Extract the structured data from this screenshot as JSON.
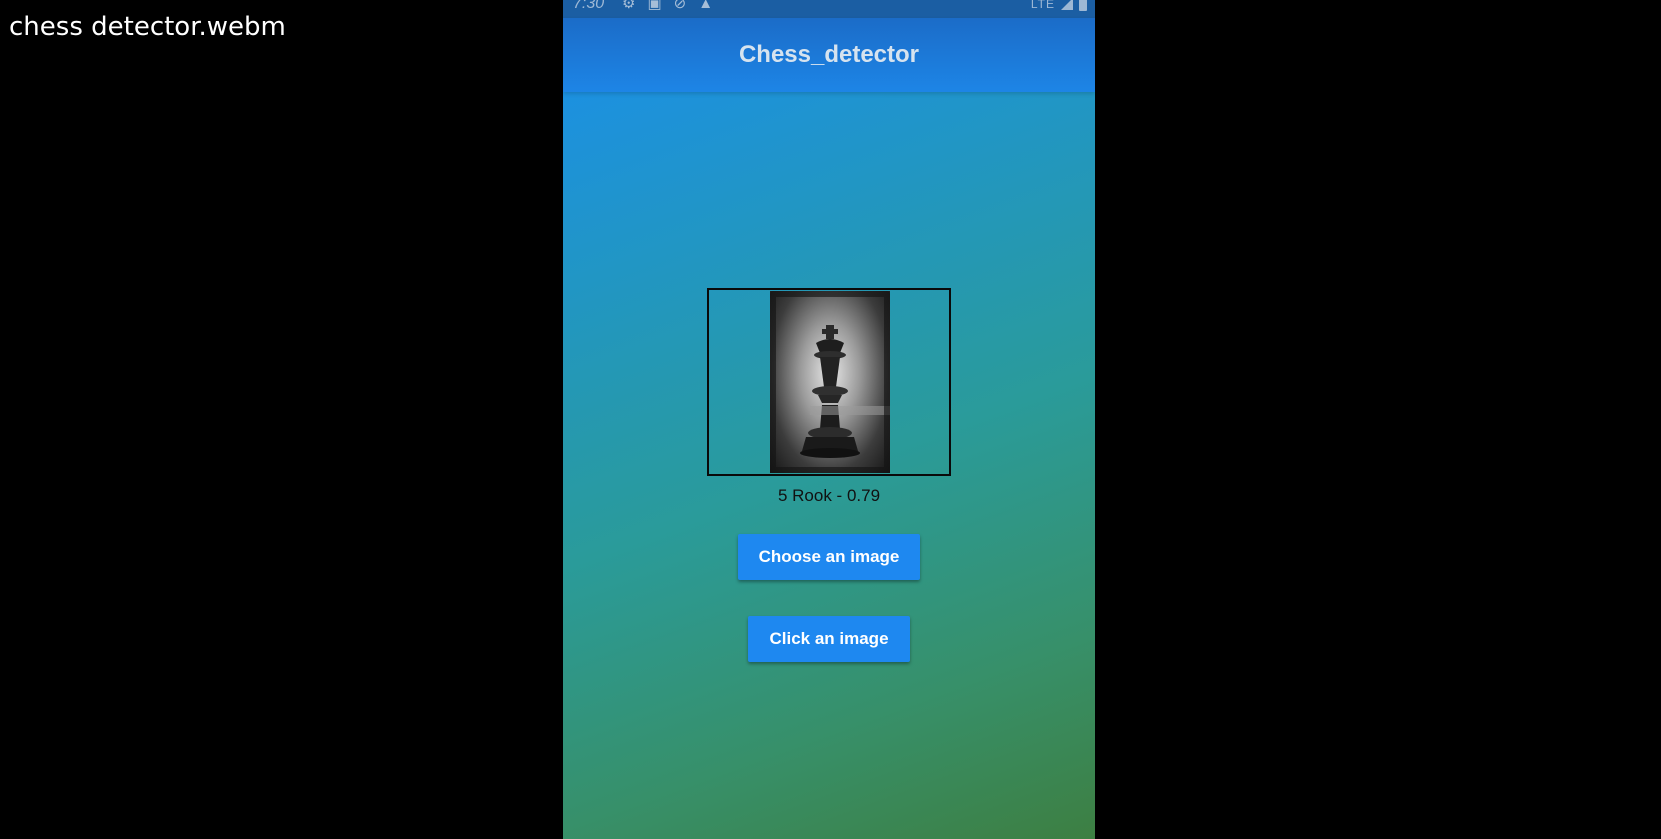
{
  "video": {
    "title": "chess detector.webm"
  },
  "status_bar": {
    "time": "7:30",
    "icons_left": [
      "gear-icon",
      "image-icon",
      "sync-off-icon",
      "warning-icon"
    ],
    "network": "LTE",
    "bg_color": "#1b5ea3"
  },
  "app_bar": {
    "title": "Chess_detector",
    "color": "#1d85e6"
  },
  "preview": {
    "subject": "chess king piece photo"
  },
  "result": {
    "label": "5 Rook - 0.79"
  },
  "actions": {
    "choose_label": "Choose an image",
    "click_label": "Click an image",
    "button_color": "#1e88f0"
  }
}
